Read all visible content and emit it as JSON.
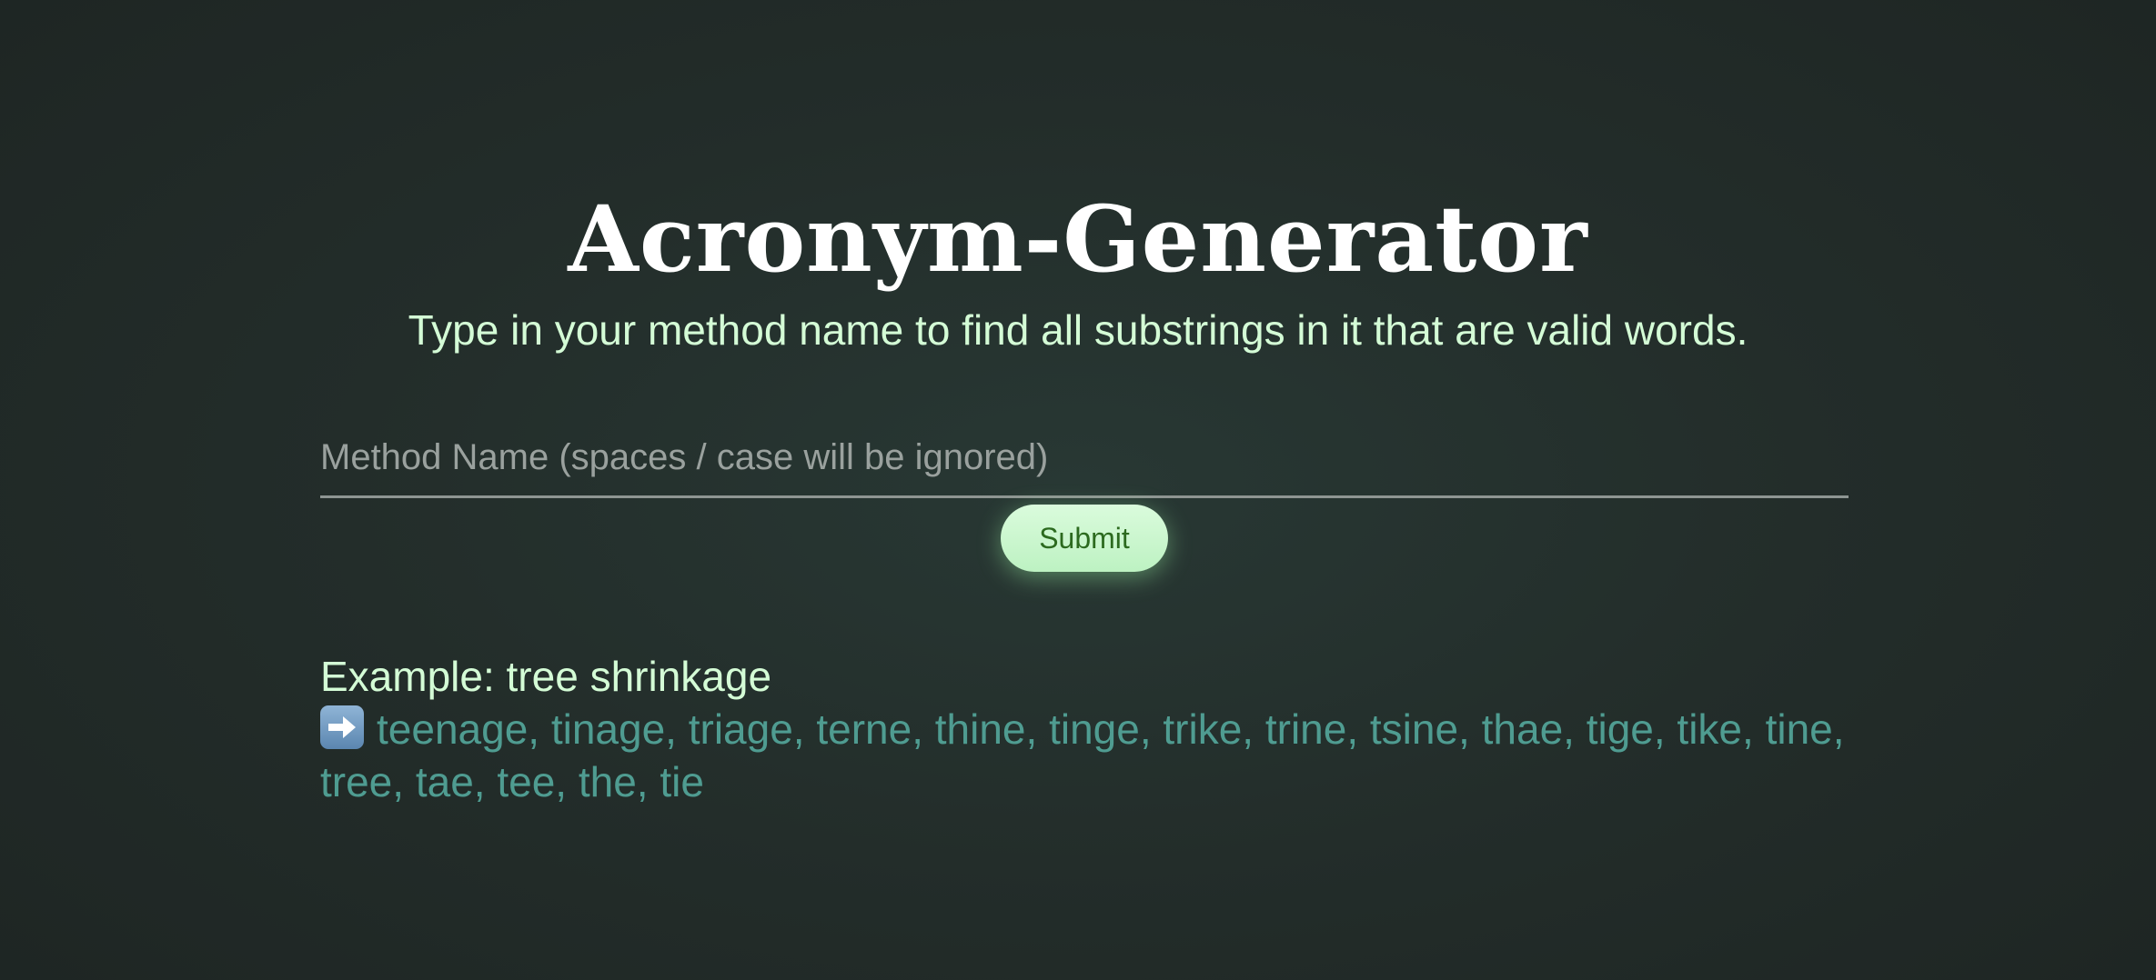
{
  "header": {
    "title": "Acronym-Generator",
    "subtitle": "Type in your method name to find all substrings in it that are valid words."
  },
  "form": {
    "input_placeholder": "Method Name (spaces / case will be ignored)",
    "input_value": "",
    "submit_label": "Submit"
  },
  "example": {
    "label": "Example: tree shrinkage",
    "result_icon": "right-arrow-icon",
    "results": "teenage, tinage, triage, terne, thine, tinge, trike, trine, tsine, thae, tige, tike, tine, tree, tae, tee, the, tie"
  },
  "colors": {
    "background": "#232d2a",
    "title": "#ffffff",
    "subtitle": "#d4fcd6",
    "results": "#4f9c91",
    "button_bg": "#c9f6cd",
    "button_text": "#2c6a1f"
  }
}
